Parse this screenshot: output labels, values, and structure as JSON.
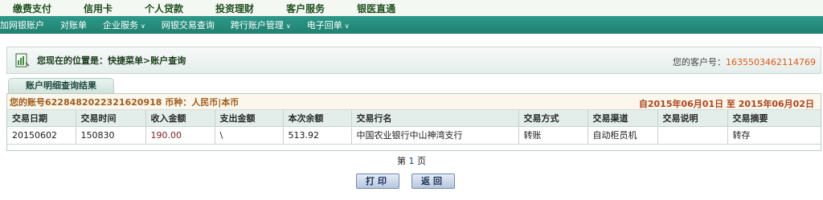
{
  "top_nav": [
    "缴费支付",
    "信用卡",
    "个人贷款",
    "投资理财",
    "客户服务",
    "银医直通"
  ],
  "sub_nav": [
    {
      "label": "加网银账户",
      "dropdown": false
    },
    {
      "label": "对账单",
      "dropdown": false
    },
    {
      "label": "企业服务",
      "dropdown": true
    },
    {
      "label": "网银交易查询",
      "dropdown": false
    },
    {
      "label": "跨行账户管理",
      "dropdown": true
    },
    {
      "label": "电子回单",
      "dropdown": true
    }
  ],
  "location": {
    "prefix": "您现在的位置是：",
    "path": "快捷菜单>账户查询",
    "customer_label": "您的客户号：",
    "customer_number": "1635503462114769"
  },
  "tab_label": "账户明细查询结果",
  "summary": {
    "account": "您的账号6228482022321620918 币种：人民币|本币",
    "date_range": "自2015年06月01日 至 2015年06月02日"
  },
  "table": {
    "columns": [
      "交易日期",
      "交易时间",
      "收入金额",
      "支出金额",
      "本次余额",
      "交易行名",
      "交易方式",
      "交易渠道",
      "交易说明",
      "交易摘要"
    ],
    "rows": [
      [
        "20150602",
        "150830",
        "190.00",
        "\\",
        "513.92",
        "中国农业银行中山神湾支行",
        "转账",
        "自动柜员机",
        "",
        "转存"
      ]
    ]
  },
  "pager": {
    "prefix": "第",
    "page": "1",
    "suffix": "页"
  },
  "buttons": {
    "print": "打印",
    "back": "返回"
  },
  "colors": {
    "subnav": "#1f8070",
    "accent": "#e05a12"
  }
}
